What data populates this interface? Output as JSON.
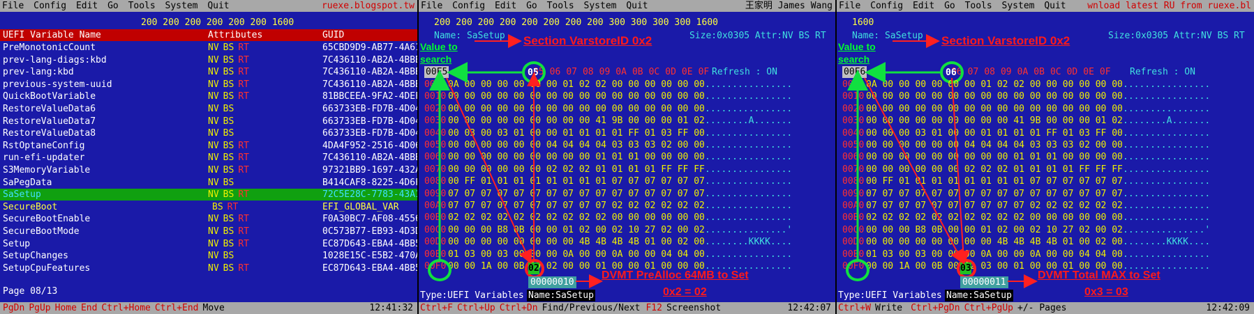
{
  "menu": [
    "File",
    "Config",
    "Edit",
    "Go",
    "Tools",
    "System",
    "Quit"
  ],
  "left": {
    "menu_right": "ruexe.blogspot.tw",
    "widths": "200 200 200 200 200 200 1600",
    "header": {
      "name": "UEFI Variable Name",
      "attr": "Attributes",
      "guid": "GUID"
    },
    "rows": [
      {
        "name": "PreMonotonicCount",
        "nv": "NV",
        "bs": "BS",
        "rt": "RT",
        "guid": "65CBD9D9-AB77-4A61"
      },
      {
        "name": "prev-lang-diags:kbd",
        "nv": "NV",
        "bs": "BS",
        "rt": "RT",
        "guid": "7C436110-AB2A-4BBB"
      },
      {
        "name": "prev-lang:kbd",
        "nv": "NV",
        "bs": "BS",
        "rt": "RT",
        "guid": "7C436110-AB2A-4BBB"
      },
      {
        "name": "previous-system-uuid",
        "nv": "NV",
        "bs": "BS",
        "rt": "RT",
        "guid": "7C436110-AB2A-4BBB"
      },
      {
        "name": "QuickBootVariable",
        "nv": "NV",
        "bs": "BS",
        "rt": "RT",
        "guid": "81BBCEEA-9FA2-4DEF"
      },
      {
        "name": "RestoreValueData6",
        "nv": "NV",
        "bs": "BS",
        "rt": "",
        "guid": "663733EB-FD7B-4D04"
      },
      {
        "name": "RestoreValueData7",
        "nv": "NV",
        "bs": "BS",
        "rt": "",
        "guid": "663733EB-FD7B-4D04"
      },
      {
        "name": "RestoreValueData8",
        "nv": "NV",
        "bs": "BS",
        "rt": "",
        "guid": "663733EB-FD7B-4D04"
      },
      {
        "name": "RstOptaneConfig",
        "nv": "NV",
        "bs": "BS",
        "rt": "RT",
        "guid": "4DA4F952-2516-4D06"
      },
      {
        "name": "run-efi-updater",
        "nv": "NV",
        "bs": "BS",
        "rt": "RT",
        "guid": "7C436110-AB2A-4BBB"
      },
      {
        "name": "S3MemoryVariable",
        "nv": "NV",
        "bs": "BS",
        "rt": "RT",
        "guid": "97321BB9-1697-432A"
      },
      {
        "name": "SaPegData",
        "nv": "NV",
        "bs": "BS",
        "rt": "",
        "guid": "B414CAF8-8225-4D6F"
      },
      {
        "name": "SaSetup",
        "nv": "NV",
        "bs": "BS",
        "rt": "RT",
        "guid": "72C5E28C-7783-43A1"
      },
      {
        "name": "SecureBoot",
        "nv": "",
        "bs": "BS",
        "rt": "RT",
        "guid": "EFI_GLOBAL_VAR"
      },
      {
        "name": "SecureBootEnable",
        "nv": "NV",
        "bs": "BS",
        "rt": "RT",
        "guid": "F0A30BC7-AF08-4556"
      },
      {
        "name": "SecureBootMode",
        "nv": "NV",
        "bs": "BS",
        "rt": "RT",
        "guid": "0C573B77-EB93-4D3D"
      },
      {
        "name": "Setup",
        "nv": "NV",
        "bs": "BS",
        "rt": "RT",
        "guid": "EC87D643-EBA4-4BB5"
      },
      {
        "name": "SetupChanges",
        "nv": "NV",
        "bs": "BS",
        "rt": "",
        "guid": "1028E15C-E5B2-470A"
      },
      {
        "name": "SetupCpuFeatures",
        "nv": "NV",
        "bs": "BS",
        "rt": "RT",
        "guid": "EC87D643-EBA4-4BB5"
      }
    ],
    "page": "Page 08/13",
    "status_keys": [
      "PgDn",
      "PgUp",
      "Home",
      "End",
      "Ctrl+Home",
      "Ctrl+End"
    ],
    "status_action": "Move",
    "time": "12:41:32"
  },
  "mid": {
    "menu_right": "王家明 James Wang",
    "widths": "200 200 200 200 200 200 200 200 300 300 300 300 1600",
    "name_label": "Name: SaSetup",
    "size_info": "Size:0x0305 Attr:NV BS RT",
    "section_note": "Section VarstoreID 0x2",
    "value_note": "Value to search",
    "addr_head": "00F5",
    "hex_head": [
      "05",
      "06",
      "07",
      "08",
      "09",
      "0A",
      "0B",
      "0C",
      "0D",
      "0E",
      "0F"
    ],
    "circled_head": "05",
    "refresh": "Refresh    : ON",
    "rows": [
      {
        "addr": "0000",
        "bytes": "0A 00 00 00 00 00 00 01 02 02 00 00 00 00 00 00",
        "ascii": "................"
      },
      {
        "addr": "0010",
        "bytes": "00 00 00 00 00 00 00 00 00 00 00 00 00 00 00 00",
        "ascii": "................"
      },
      {
        "addr": "0020",
        "bytes": "00 00 00 00 00 00 00 00 00 00 00 00 00 00 00 00",
        "ascii": "................"
      },
      {
        "addr": "0030",
        "bytes": "00 00 00 00 00 00 00 00 00 41 9B 00 00 00 01 02",
        "ascii": "........A......."
      },
      {
        "addr": "0040",
        "bytes": "00 03 00 03 01 00 00 01 01 01 01 FF 01 03 FF 00",
        "ascii": "................"
      },
      {
        "addr": "0050",
        "bytes": "00 00 00 00 00 00 04 04 04 04 03 03 03 02 00 00",
        "ascii": "................"
      },
      {
        "addr": "0060",
        "bytes": "00 00 00 00 00 00 00 00 00 01 01 01 00 00 00 00",
        "ascii": "................"
      },
      {
        "addr": "0070",
        "bytes": "00 00 00 00 00 00 02 02 02 01 01 01 01 FF FF FF",
        "ascii": "................"
      },
      {
        "addr": "0080",
        "bytes": "00 FF 01 01 01 01 01 01 01 01 07 07 07 07 07 07",
        "ascii": "................"
      },
      {
        "addr": "0090",
        "bytes": "07 07 07 07 07 07 07 07 07 07 07 07 07 07 07 07",
        "ascii": "................"
      },
      {
        "addr": "00A0",
        "bytes": "07 07 07 07 07 07 07 07 07 07 02 02 02 02 02 02",
        "ascii": "................"
      },
      {
        "addr": "00B0",
        "bytes": "02 02 02 02 02 02 02 02 02 02 00 00 00 00 00 00",
        "ascii": "................"
      },
      {
        "addr": "00C0",
        "bytes": "00 00 00 B8 0B 00 00 01 02 00 02 10 27 02 00 02",
        "ascii": "...............'"
      },
      {
        "addr": "00D0",
        "bytes": "00 00 00 00 00 00 00 00 4B 4B 4B 4B 01 00 02 00",
        "ascii": "........KKKK...."
      },
      {
        "addr": "00E0",
        "bytes": "01 03 00 03 00 00 00 0A 00 00 0A 00 00 04 04 00",
        "ascii": "................"
      },
      {
        "addr": "00F0",
        "bytes": "00 00 1A 00 0B 00 02 00 00 01 00 00 01 00 00 00",
        "ascii": "................"
      }
    ],
    "circled_value": "02",
    "offset_box": "00000010",
    "dvmt_note_1": "DVMT PreAlloc 64MB to Set",
    "dvmt_note_2": "0x2 = 02",
    "type_line": "Type:UEFI Variables",
    "name_line": "Name:SaSetup",
    "status_keys": [
      "Ctrl+F",
      "Ctrl+Up",
      "Ctrl+Dn"
    ],
    "status_action": "Find/Previous/Next",
    "status_key2": "F12",
    "status_action2": "Screenshot",
    "time": "12:42:07"
  },
  "right": {
    "menu_right": "wnload latest RU from ruexe.bl",
    "widths": "1600",
    "name_label": "Name: SaSetup",
    "size_info": "Size:0x0305 Attr:NV BS RT",
    "section_note": "Section VarstoreID 0x2",
    "value_note": "Value to search",
    "addr_head": "00F6",
    "hex_head": [
      "06",
      "07",
      "08",
      "09",
      "0A",
      "0B",
      "0C",
      "0D",
      "0E",
      "0F"
    ],
    "circled_head": "06",
    "refresh": "Refresh    : ON",
    "rows": [
      {
        "addr": "0000",
        "bytes": "0A 00 00 00 00 00 00 01 02 02 00 00 00 00 00 00",
        "ascii": "................"
      },
      {
        "addr": "0010",
        "bytes": "00 00 00 00 00 00 00 00 00 00 00 00 00 00 00 00",
        "ascii": "................"
      },
      {
        "addr": "0020",
        "bytes": "00 00 00 00 00 00 00 00 00 00 00 00 00 00 00 00",
        "ascii": "................"
      },
      {
        "addr": "0030",
        "bytes": "00 00 00 00 00 00 00 00 00 41 9B 00 00 00 01 02",
        "ascii": "........A......."
      },
      {
        "addr": "0040",
        "bytes": "00 00 00 03 01 00 00 01 01 01 01 FF 01 03 FF 00",
        "ascii": "................"
      },
      {
        "addr": "0050",
        "bytes": "00 00 00 00 00 00 04 04 04 04 03 03 03 02 00 00",
        "ascii": "................"
      },
      {
        "addr": "0060",
        "bytes": "00 00 00 00 00 00 00 00 00 01 01 01 00 00 00 00",
        "ascii": "................"
      },
      {
        "addr": "0070",
        "bytes": "00 00 00 00 00 00 02 02 02 01 01 01 01 FF FF FF",
        "ascii": "................"
      },
      {
        "addr": "0080",
        "bytes": "00 FF 01 01 01 01 01 01 01 01 07 07 07 07 07 07",
        "ascii": "................"
      },
      {
        "addr": "0090",
        "bytes": "07 07 07 07 07 07 07 07 07 07 07 07 07 07 07 07",
        "ascii": "................"
      },
      {
        "addr": "00A0",
        "bytes": "07 07 07 07 07 07 07 07 07 07 02 02 02 02 02 02",
        "ascii": "................"
      },
      {
        "addr": "00B0",
        "bytes": "02 02 02 02 02 02 02 02 02 02 00 00 00 00 00 00",
        "ascii": "................"
      },
      {
        "addr": "00C0",
        "bytes": "00 00 00 B8 0B 00 00 01 02 00 02 10 27 02 00 02",
        "ascii": "...............'"
      },
      {
        "addr": "00D0",
        "bytes": "00 00 00 00 00 00 00 00 4B 4B 4B 4B 01 00 02 00",
        "ascii": "........KKKK...."
      },
      {
        "addr": "00E0",
        "bytes": "01 03 00 03 00 00 00 0A 00 00 0A 00 00 04 04 00",
        "ascii": "................"
      },
      {
        "addr": "00F0",
        "bytes": "00 00 1A 00 0B 00 02 03 00 01 00 00 01 00 00 00",
        "ascii": "................"
      }
    ],
    "circled_value": "03",
    "offset_box": "00000011",
    "dvmt_note_1": "DVMT Total MAX to Set",
    "dvmt_note_2": "0x3 = 03",
    "type_line": "Type:UEFI Variables",
    "name_line": "Name:SaSetup",
    "status_key1": "Ctrl+W",
    "status_action1": "Write",
    "status_keys": [
      "Ctrl+PgDn",
      "Ctrl+PgUp"
    ],
    "status_action": "+/- Pages",
    "time": "12:42:09"
  }
}
